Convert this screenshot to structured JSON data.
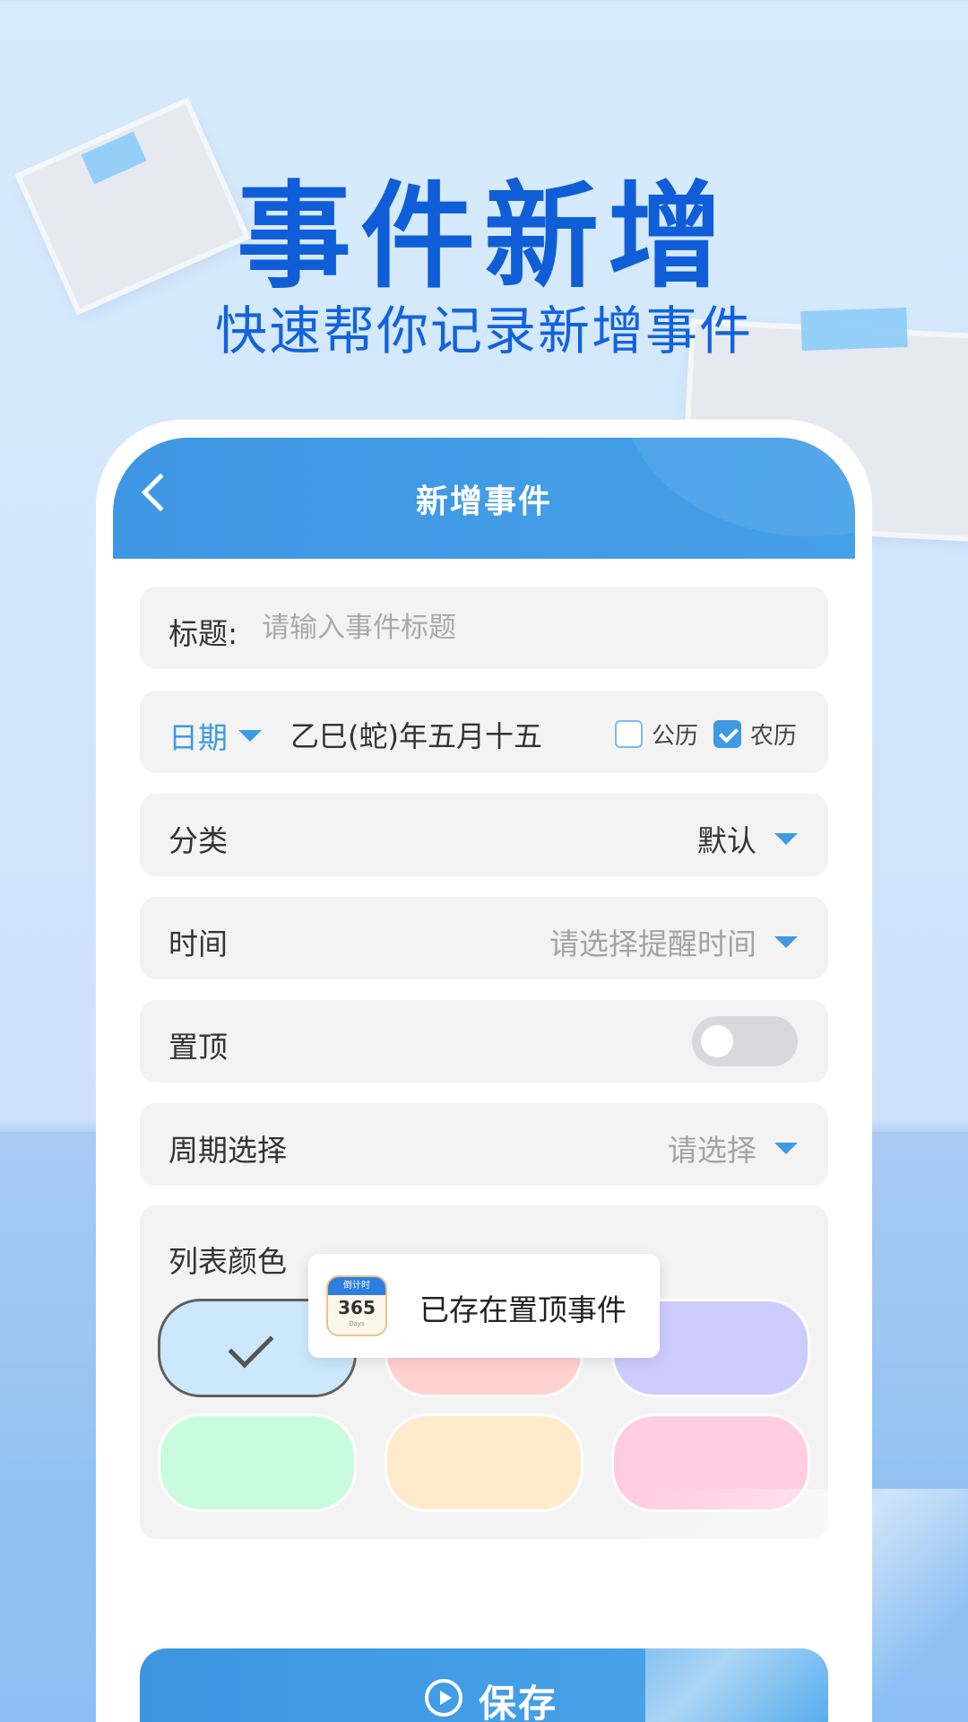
{
  "hero": {
    "title": "事件新增",
    "subtitle": "快速帮你记录新增事件"
  },
  "appbar": {
    "title": "新增事件"
  },
  "form": {
    "title_label": "标题:",
    "title_placeholder": "请输入事件标题",
    "date_label": "日期",
    "date_value": "乙巳(蛇)年五月十五",
    "solar_label": "公历",
    "lunar_label": "农历",
    "solar_checked": false,
    "lunar_checked": true,
    "category_label": "分类",
    "category_value": "默认",
    "time_label": "时间",
    "time_placeholder": "请选择提醒时间",
    "pin_label": "置顶",
    "pin_enabled": false,
    "cycle_label": "周期选择",
    "cycle_placeholder": "请选择",
    "color_label": "列表颜色",
    "colors": [
      "#cce8fd",
      "#ffd2d0",
      "#ccccff",
      "#c9fcdf",
      "#ffeacc",
      "#ffcde0"
    ],
    "selected_color_index": 0
  },
  "toast": {
    "text": "已存在置顶事件",
    "icon_header": "倒计时",
    "icon_number": "365",
    "icon_caption": "Days"
  },
  "save_label": "保存",
  "icons": {
    "back": "chevron-left-icon",
    "dropdown": "caret-down-icon",
    "check": "check-icon",
    "save": "play-circle-icon",
    "app": "calendar-365-icon"
  },
  "colors": {
    "brand": "#3d9ae3",
    "hero_text": "#0f5ed8"
  }
}
